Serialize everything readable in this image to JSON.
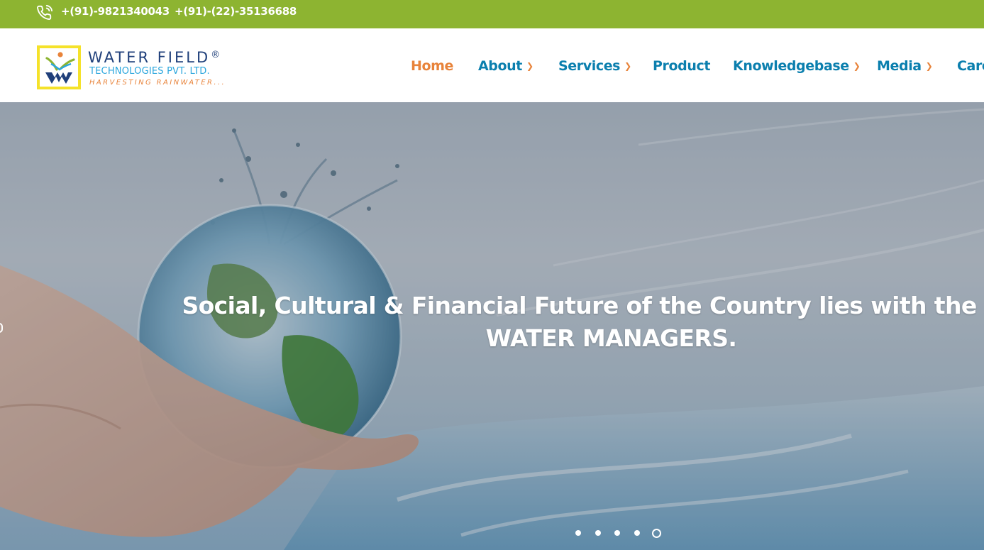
{
  "topbar": {
    "phone_primary": "+(91)-9821340043",
    "phone_secondary": "+(91)-(22)-35136688",
    "icon": "phone-call-icon"
  },
  "brand": {
    "name": "WATER FIELD",
    "registered_mark": "®",
    "subtitle": "TECHNOLOGIES PVT. LTD.",
    "tagline": "HARVESTING RAINWATER...",
    "colors": {
      "name": "#1f3f7a",
      "subtitle": "#2aa6dd",
      "tagline": "#e8833a",
      "frame": "#f5e22a"
    }
  },
  "nav": {
    "items": [
      {
        "label": "Home",
        "active": true,
        "dropdown": false
      },
      {
        "label": "About",
        "active": false,
        "dropdown": true
      },
      {
        "label": "Services",
        "active": false,
        "dropdown": true
      },
      {
        "label": "Product",
        "active": false,
        "dropdown": false
      },
      {
        "label": "Knowledgebase",
        "active": false,
        "dropdown": true
      },
      {
        "label": "Media",
        "active": false,
        "dropdown": true
      },
      {
        "label": "Care",
        "active": false,
        "dropdown": false
      }
    ],
    "chevron_icon": "chevron-down-icon"
  },
  "hero": {
    "headline_line1": "Social, Cultural & Financial Future of the Country lies with the best",
    "headline_line2": "WATER MANAGERS.",
    "slides_total": 5,
    "active_slide": 5
  },
  "colors": {
    "topbar": "#8db431",
    "nav_link": "#0b7fae",
    "nav_active": "#e8833a",
    "accent": "#e8833a"
  }
}
